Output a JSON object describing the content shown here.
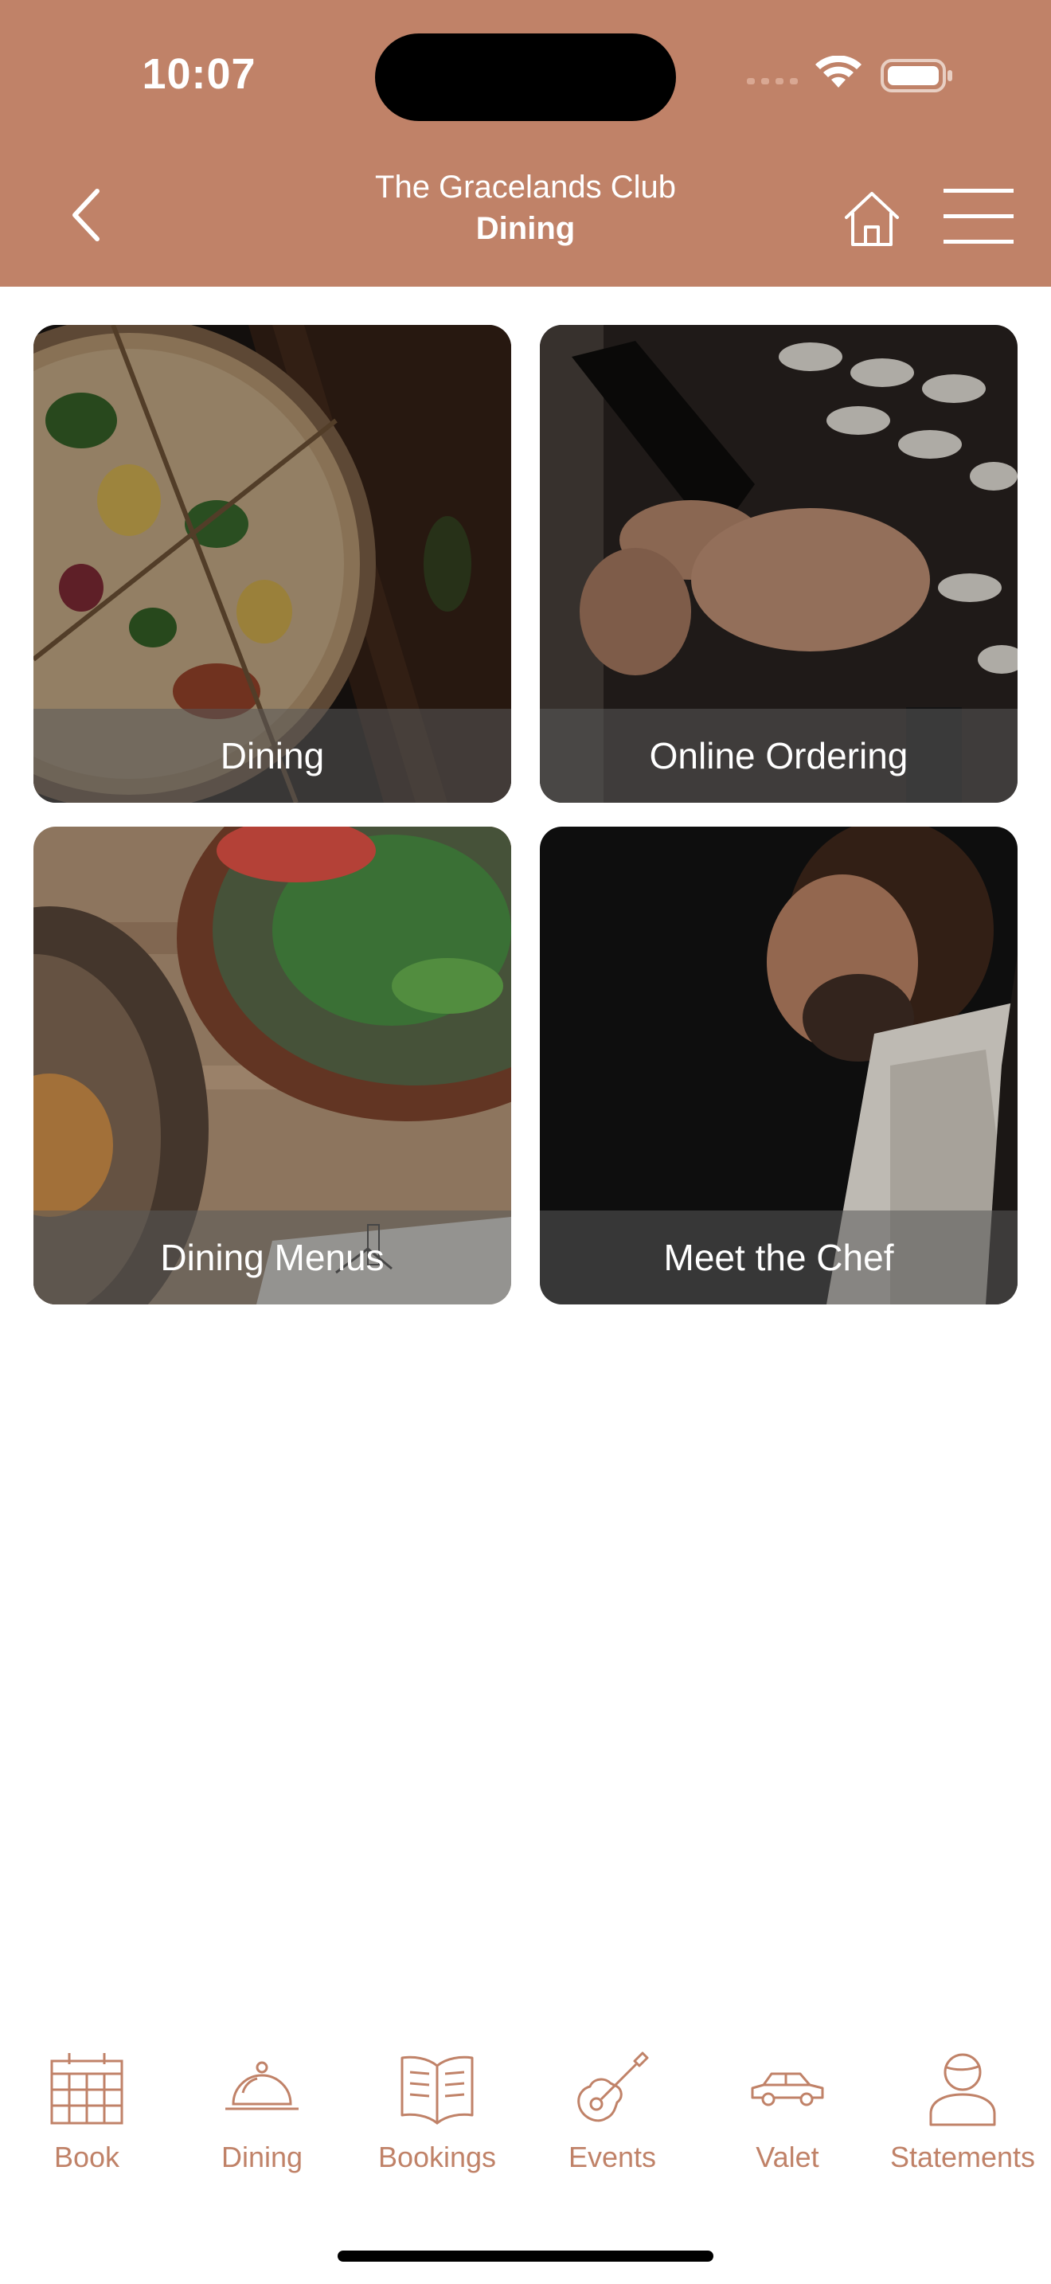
{
  "status_bar": {
    "time": "10:07"
  },
  "header": {
    "title": "The Gracelands Club",
    "subtitle": "Dining",
    "background_color": "#c08268",
    "back_icon": "chevron-left-icon",
    "home_icon": "home-icon",
    "menu_icon": "hamburger-menu-icon"
  },
  "tiles": [
    {
      "label": "Dining",
      "image": "pizza-on-board-photo"
    },
    {
      "label": "Online Ordering",
      "image": "phone-in-hands-photo"
    },
    {
      "label": "Dining Menus",
      "image": "salad-bowl-photo"
    },
    {
      "label": "Meet the Chef",
      "image": "chef-portrait-photo"
    }
  ],
  "tabbar": {
    "accent_color": "#c08268",
    "items": [
      {
        "label": "Book",
        "icon": "calendar-icon"
      },
      {
        "label": "Dining",
        "icon": "cloche-icon"
      },
      {
        "label": "Bookings",
        "icon": "open-book-icon"
      },
      {
        "label": "Events",
        "icon": "guitar-icon"
      },
      {
        "label": "Valet",
        "icon": "car-icon"
      },
      {
        "label": "Statements",
        "icon": "person-icon"
      }
    ]
  }
}
